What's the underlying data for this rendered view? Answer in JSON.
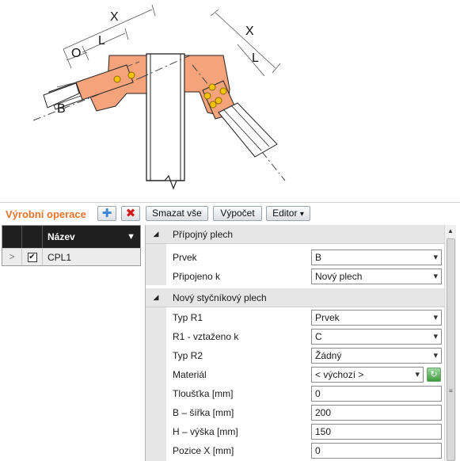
{
  "diagram": {
    "labels": {
      "x_left": "X",
      "l_left": "L",
      "o_left": "O",
      "b_left": "B",
      "x_right": "X",
      "l_right": "L"
    },
    "colors": {
      "plate": "#f4a37a",
      "bolt": "#f5c400",
      "member": "#ffffff"
    }
  },
  "toolbar": {
    "title": "Výrobní operace",
    "add_icon": "plus-icon",
    "delete_icon": "delete-x-icon",
    "clear_all_label": "Smazat vše",
    "calculate_label": "Výpočet",
    "editor_label": "Editor",
    "editor_arrow": "▾"
  },
  "ops_grid": {
    "header": {
      "name_col": "Název",
      "filter_icon": "filter-icon"
    },
    "rows": [
      {
        "expander": ">",
        "checked": "✔",
        "name": "CPL1"
      }
    ]
  },
  "properties": {
    "sections": [
      {
        "label": "Přípojný plech",
        "rows": [
          {
            "name": "Prvek",
            "value": "B"
          },
          {
            "name": "Připojeno k",
            "value": "Nový plech"
          }
        ]
      },
      {
        "label": "Nový styčníkový plech",
        "rows": [
          {
            "name": "Typ R1",
            "value": "Prvek"
          },
          {
            "name": "R1 - vztaženo k",
            "value": "C"
          },
          {
            "name": "Typ R2",
            "value": "Žádný"
          },
          {
            "name": "Materiál",
            "value": "< výchozí >"
          },
          {
            "name": "Tloušťka [mm]",
            "value": "0"
          },
          {
            "name": "B – šířka [mm]",
            "value": "200"
          },
          {
            "name": "H – výška [mm]",
            "value": "150"
          },
          {
            "name": "Pozice X [mm]",
            "value": "0"
          }
        ]
      }
    ]
  }
}
